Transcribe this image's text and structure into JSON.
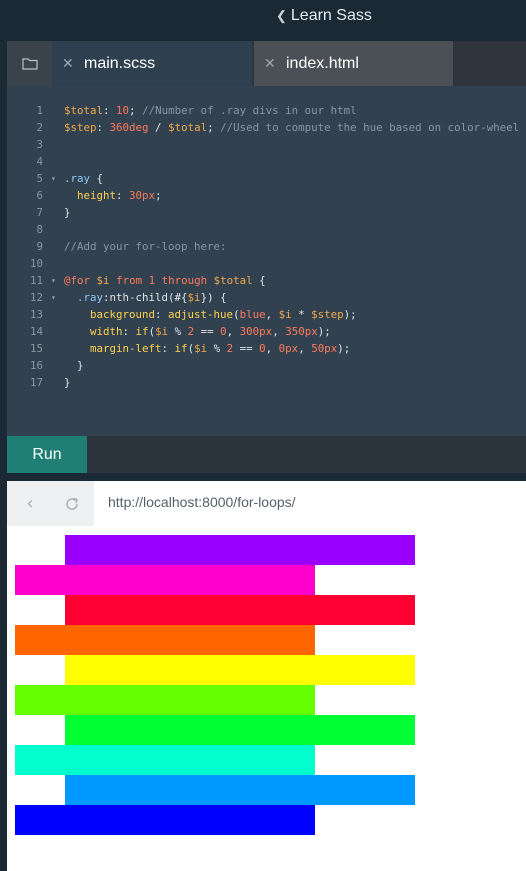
{
  "header": {
    "course_title": "Learn Sass",
    "back_icon": "chevron-left-icon"
  },
  "tabs": [
    {
      "label": "main.scss",
      "active": true
    },
    {
      "label": "index.html",
      "active": false
    }
  ],
  "code_lines": [
    {
      "n": "1",
      "fold": false,
      "tokens": [
        [
          "var",
          "$total"
        ],
        [
          "pl",
          ": "
        ],
        [
          "num",
          "10"
        ],
        [
          "pl",
          "; "
        ],
        [
          "com",
          "//Number of .ray divs in our html"
        ]
      ]
    },
    {
      "n": "2",
      "fold": false,
      "tokens": [
        [
          "var",
          "$step"
        ],
        [
          "pl",
          ": "
        ],
        [
          "num",
          "360deg"
        ],
        [
          "pl",
          " / "
        ],
        [
          "var",
          "$total"
        ],
        [
          "pl",
          "; "
        ],
        [
          "com",
          "//Used to compute the hue based on color-wheel"
        ]
      ]
    },
    {
      "n": "3",
      "fold": false,
      "tokens": []
    },
    {
      "n": "4",
      "fold": false,
      "tokens": []
    },
    {
      "n": "5",
      "fold": true,
      "tokens": [
        [
          "sel",
          ".ray"
        ],
        [
          "pl",
          " {"
        ]
      ]
    },
    {
      "n": "6",
      "fold": false,
      "tokens": [
        [
          "pl",
          "  "
        ],
        [
          "prop",
          "height"
        ],
        [
          "pl",
          ": "
        ],
        [
          "num",
          "30px"
        ],
        [
          "pl",
          ";"
        ]
      ]
    },
    {
      "n": "7",
      "fold": false,
      "tokens": [
        [
          "pl",
          "}"
        ]
      ]
    },
    {
      "n": "8",
      "fold": false,
      "tokens": []
    },
    {
      "n": "9",
      "fold": false,
      "tokens": [
        [
          "com",
          "//Add your for-loop here:"
        ]
      ]
    },
    {
      "n": "10",
      "fold": false,
      "tokens": []
    },
    {
      "n": "11",
      "fold": true,
      "tokens": [
        [
          "kw",
          "@for"
        ],
        [
          "pl",
          " "
        ],
        [
          "var",
          "$i"
        ],
        [
          "pl",
          " "
        ],
        [
          "kw",
          "from"
        ],
        [
          "pl",
          " "
        ],
        [
          "num",
          "1"
        ],
        [
          "pl",
          " "
        ],
        [
          "kw",
          "through"
        ],
        [
          "pl",
          " "
        ],
        [
          "var",
          "$total"
        ],
        [
          "pl",
          " {"
        ]
      ]
    },
    {
      "n": "12",
      "fold": true,
      "tokens": [
        [
          "pl",
          "  "
        ],
        [
          "sel",
          ".ray"
        ],
        [
          "pl",
          ":nth-child(#{"
        ],
        [
          "var",
          "$i"
        ],
        [
          "pl",
          "}) {"
        ]
      ]
    },
    {
      "n": "13",
      "fold": false,
      "tokens": [
        [
          "pl",
          "    "
        ],
        [
          "prop",
          "background"
        ],
        [
          "pl",
          ": "
        ],
        [
          "fn",
          "adjust-hue"
        ],
        [
          "pl",
          "("
        ],
        [
          "num",
          "blue"
        ],
        [
          "pl",
          ", "
        ],
        [
          "var",
          "$i"
        ],
        [
          "pl",
          " * "
        ],
        [
          "var",
          "$step"
        ],
        [
          "pl",
          ");"
        ]
      ]
    },
    {
      "n": "14",
      "fold": false,
      "tokens": [
        [
          "pl",
          "    "
        ],
        [
          "prop",
          "width"
        ],
        [
          "pl",
          ": "
        ],
        [
          "fn",
          "if"
        ],
        [
          "pl",
          "("
        ],
        [
          "var",
          "$i"
        ],
        [
          "pl",
          " % "
        ],
        [
          "num",
          "2"
        ],
        [
          "pl",
          " == "
        ],
        [
          "num",
          "0"
        ],
        [
          "pl",
          ", "
        ],
        [
          "num",
          "300px"
        ],
        [
          "pl",
          ", "
        ],
        [
          "num",
          "350px"
        ],
        [
          "pl",
          ");"
        ]
      ]
    },
    {
      "n": "15",
      "fold": false,
      "tokens": [
        [
          "pl",
          "    "
        ],
        [
          "prop",
          "margin-left"
        ],
        [
          "pl",
          ": "
        ],
        [
          "fn",
          "if"
        ],
        [
          "pl",
          "("
        ],
        [
          "var",
          "$i"
        ],
        [
          "pl",
          " % "
        ],
        [
          "num",
          "2"
        ],
        [
          "pl",
          " == "
        ],
        [
          "num",
          "0"
        ],
        [
          "pl",
          ", "
        ],
        [
          "num",
          "0px"
        ],
        [
          "pl",
          ", "
        ],
        [
          "num",
          "50px"
        ],
        [
          "pl",
          ");"
        ]
      ]
    },
    {
      "n": "16",
      "fold": false,
      "tokens": [
        [
          "pl",
          "  }"
        ]
      ]
    },
    {
      "n": "17",
      "fold": false,
      "tokens": [
        [
          "pl",
          "}"
        ]
      ]
    }
  ],
  "run_button": {
    "label": "Run"
  },
  "browser": {
    "url": "http://localhost:8000/for-loops/",
    "back_icon": "chevron-left-icon",
    "reload_icon": "reload-icon"
  },
  "rays": [
    {
      "color": "#9900ff",
      "odd": true
    },
    {
      "color": "#ff00cc",
      "odd": false
    },
    {
      "color": "#ff0033",
      "odd": true
    },
    {
      "color": "#ff6600",
      "odd": false
    },
    {
      "color": "#ffff00",
      "odd": true
    },
    {
      "color": "#66ff00",
      "odd": false
    },
    {
      "color": "#00ff33",
      "odd": true
    },
    {
      "color": "#00ffcc",
      "odd": false
    },
    {
      "color": "#0099ff",
      "odd": true
    },
    {
      "color": "#0000ff",
      "odd": false
    }
  ]
}
